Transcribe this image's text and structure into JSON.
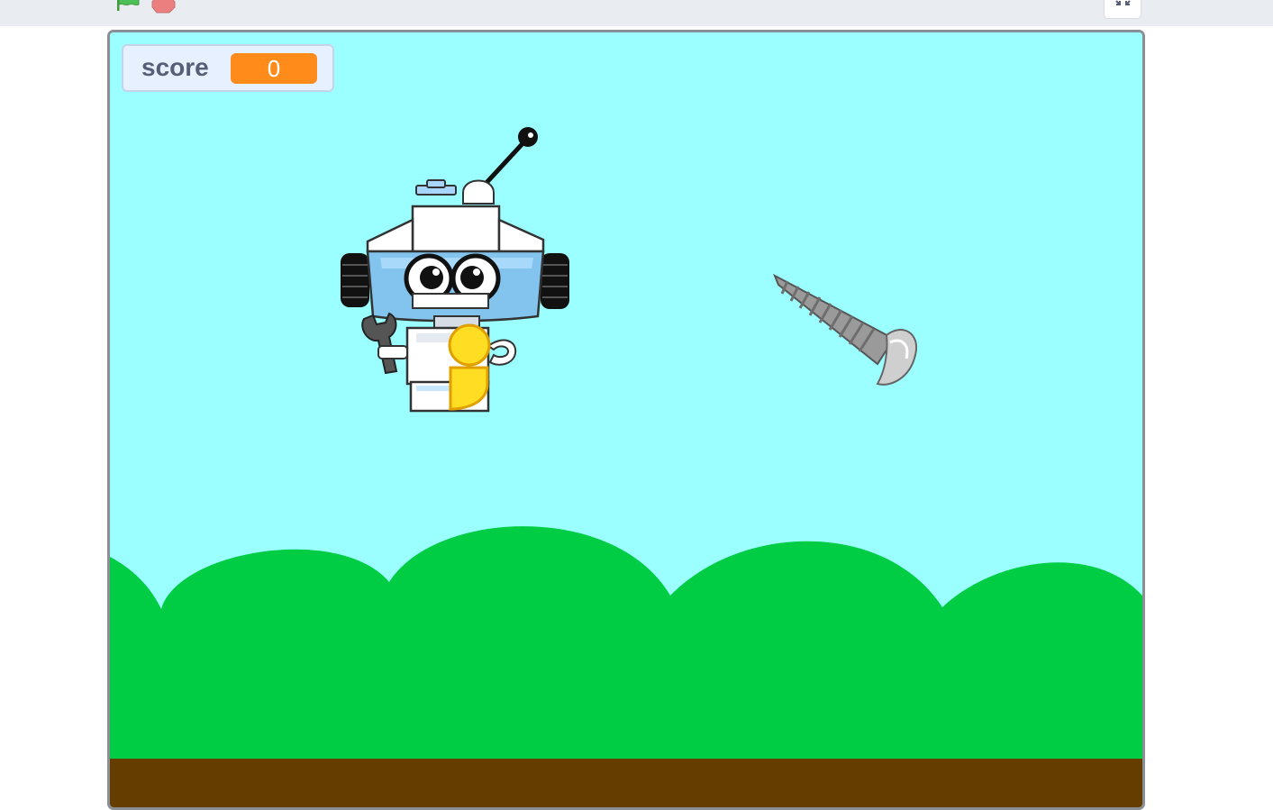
{
  "toolbar": {
    "green_flag_icon": "green-flag-icon",
    "stop_icon": "stop-sign-icon",
    "unfullscreen_icon": "unfullscreen-icon"
  },
  "stage": {
    "monitor": {
      "label": "score",
      "value": "0"
    },
    "sprites": [
      "robot",
      "screw"
    ],
    "colors": {
      "sky": "#9bffff",
      "hills": "#00cc44",
      "ground": "#663d00",
      "monitor_value": "#ff8c1a",
      "flag": "#4cbf56",
      "stop": "#ec5959"
    }
  }
}
